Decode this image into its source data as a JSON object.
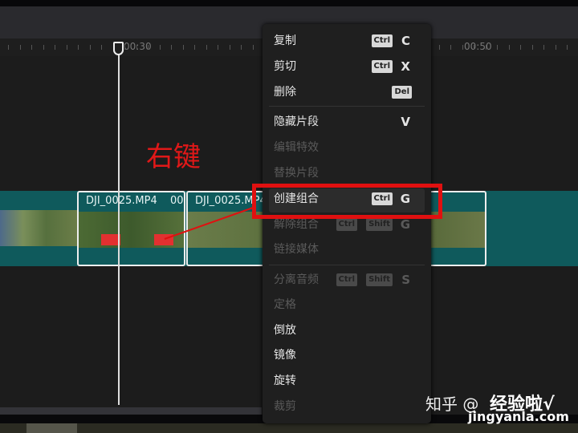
{
  "ruler": {
    "labels": [
      "00:30",
      "00:50"
    ]
  },
  "clips": [
    {
      "label": "DJI_0025.MP4",
      "trailing": "00"
    },
    {
      "label": "DJI_0025.MP4"
    }
  ],
  "annotation": "右键",
  "menu": {
    "items": [
      {
        "label": "复制",
        "keys": [
          "Ctrl"
        ],
        "key": "C",
        "enabled": true
      },
      {
        "label": "剪切",
        "keys": [
          "Ctrl"
        ],
        "key": "X",
        "enabled": true
      },
      {
        "label": "删除",
        "keys": [
          "Del"
        ],
        "key": "",
        "enabled": true
      },
      {
        "label": "隐藏片段",
        "keys": [],
        "key": "V",
        "enabled": true
      },
      {
        "label": "编辑特效",
        "keys": [],
        "key": "",
        "enabled": false
      },
      {
        "label": "替换片段",
        "keys": [],
        "key": "",
        "enabled": false
      },
      {
        "label": "创建组合",
        "keys": [
          "Ctrl"
        ],
        "key": "G",
        "enabled": true,
        "highlighted": true
      },
      {
        "label": "解除组合",
        "keys": [
          "Ctrl",
          "Shift"
        ],
        "key": "G",
        "enabled": false
      },
      {
        "label": "链接媒体",
        "keys": [],
        "key": "",
        "enabled": false
      },
      {
        "label": "分离音频",
        "keys": [
          "Ctrl",
          "Shift"
        ],
        "key": "S",
        "enabled": false
      },
      {
        "label": "定格",
        "keys": [],
        "key": "",
        "enabled": false
      },
      {
        "label": "倒放",
        "keys": [],
        "key": "",
        "enabled": true
      },
      {
        "label": "镜像",
        "keys": [],
        "key": "",
        "enabled": true
      },
      {
        "label": "旋转",
        "keys": [],
        "key": "",
        "enabled": true
      },
      {
        "label": "裁剪",
        "keys": [],
        "key": "",
        "enabled": false
      }
    ]
  },
  "watermark": {
    "zhihu": "知乎 @",
    "site": "经验啦√",
    "url": "jingyanla.com"
  },
  "colors": {
    "accent_red": "#e01010",
    "track": "#0f5a5c"
  }
}
